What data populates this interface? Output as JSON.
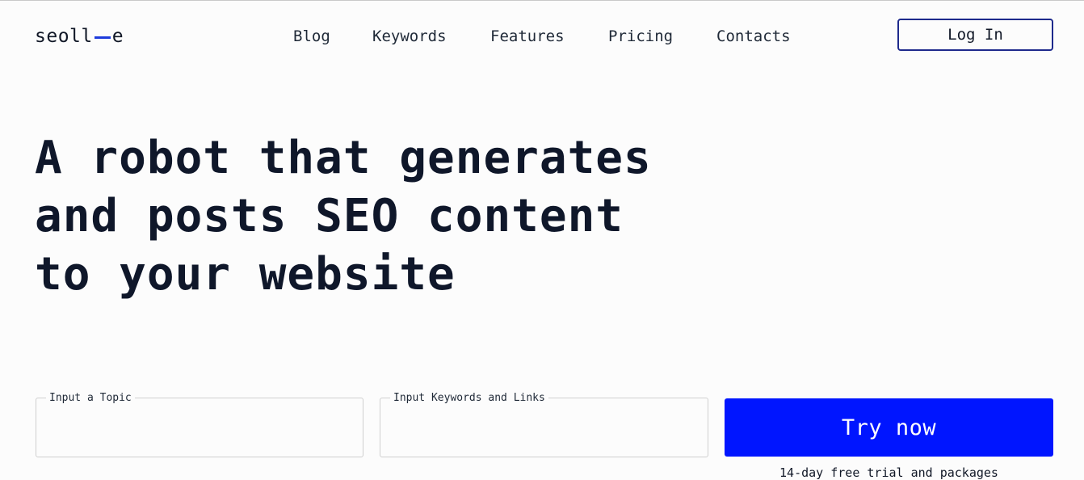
{
  "colors": {
    "accent": "#0015ff",
    "login_border": "#1e2a8c",
    "logo_dash": "#1d3bdc",
    "text": "#111827"
  },
  "header": {
    "logo_left": "seoll",
    "logo_right": "e",
    "nav": [
      "Blog",
      "Keywords",
      "Features",
      "Pricing",
      "Contacts"
    ],
    "login_label": "Log In"
  },
  "hero": {
    "lines": [
      "A robot that generates",
      "and posts SEO content",
      "to your website"
    ]
  },
  "form": {
    "topic_label": "Input a Topic",
    "topic_value": "",
    "keywords_label": "Input Keywords and Links",
    "keywords_value": "",
    "cta_label": "Try now",
    "trial_note": "14-day free trial and packages"
  }
}
